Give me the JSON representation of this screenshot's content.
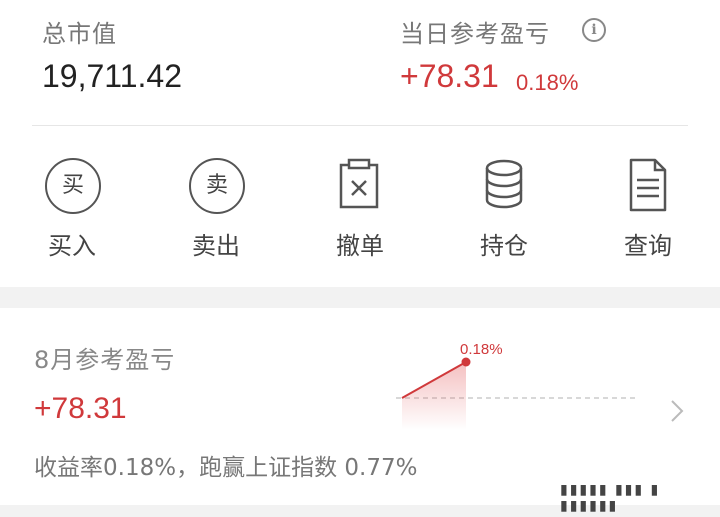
{
  "summary": {
    "total_label": "总市值",
    "total_value": "19,711.42",
    "pnl_label": "当日参考盈亏",
    "pnl_value": "+78.31",
    "pnl_pct": "0.18%",
    "info_glyph": "i"
  },
  "actions": [
    {
      "label": "买入",
      "icon": "buy-icon",
      "glyph": "买"
    },
    {
      "label": "卖出",
      "icon": "sell-icon",
      "glyph": "卖"
    },
    {
      "label": "撤单",
      "icon": "cancel-order-icon"
    },
    {
      "label": "持仓",
      "icon": "holdings-icon"
    },
    {
      "label": "查询",
      "icon": "query-document-icon"
    }
  ],
  "monthly": {
    "label": "8月参考盈亏",
    "value": "+78.31",
    "subtitle": "收益率0.18%，跑赢上证指数 0.77%",
    "chart_point_label": "0.18%"
  },
  "chart_data": {
    "type": "line",
    "x": [
      0,
      1
    ],
    "values": [
      0,
      0.18
    ],
    "point_label": "0.18%",
    "baseline": 0
  },
  "colors": {
    "accent_red": "#d0393b",
    "text_dark": "#222222",
    "text_muted": "#777777"
  }
}
